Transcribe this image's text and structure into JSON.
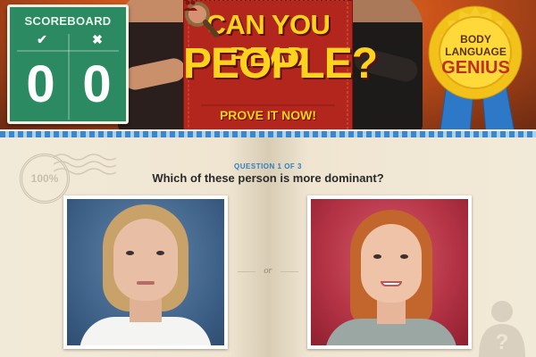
{
  "scoreboard": {
    "title": "SCOREBOARD",
    "correct_icon": "checkmark-icon",
    "wrong_icon": "cross-icon",
    "correct_glyph": "✔",
    "wrong_glyph": "✖",
    "correct_count": "0",
    "wrong_count": "0"
  },
  "banner": {
    "line1": "CAN YOU READ",
    "line2": "PEOPLE?",
    "cta": "PROVE IT NOW!",
    "icons": [
      "magnifier-icon",
      "people-icon"
    ]
  },
  "badge": {
    "line1": "BODY",
    "line2": "LANGUAGE",
    "line3": "GENIUS"
  },
  "stamp": {
    "text": "100%"
  },
  "quiz": {
    "counter": "QUESTION 1 OF 3",
    "question": "Which of these person is more dominant?",
    "separator": "or",
    "options": [
      "blonde-woman-serious-photo",
      "redhead-woman-smiling-photo"
    ],
    "help_icon": "question-person-icon"
  },
  "colors": {
    "scoreboard_green": "#2b8a62",
    "banner_red": "#b3261e",
    "banner_text_yellow": "#ffd21e",
    "badge_gold": "#f2c21a",
    "ribbon_blue": "#2e78c8",
    "question_blue": "#2f7fc4",
    "paper": "#efe6d4"
  }
}
